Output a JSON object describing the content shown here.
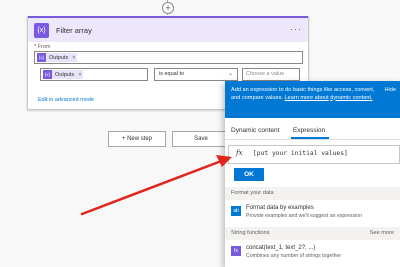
{
  "add_step_symbol": "+",
  "action": {
    "icon_text": "{x}",
    "title": "Filter array",
    "more": "···",
    "from_label": "From",
    "from_required": "*",
    "from_token": {
      "icon_text": "{x}",
      "label": "Outputs",
      "close": "×"
    },
    "value_token": {
      "icon_text": "{x}",
      "label": "Outputs",
      "close": "×"
    },
    "operator_value": "is equal to",
    "operator_chevron": "⌄",
    "value_placeholder": "Choose a value",
    "advanced_link": "Edit in advanced mode"
  },
  "buttons": {
    "new_step": "+ New step",
    "save": "Save"
  },
  "expression_panel": {
    "info_text_1": "Add an expression to do basic things like access, convert, and compare values.",
    "info_link_1": "Learn more about",
    "info_link_2": "dynamic content.",
    "hide": "Hide",
    "tabs": {
      "dynamic": "Dynamic content",
      "expression": "Expression"
    },
    "fx_icon": "fx",
    "input_value": "[put your initial values]",
    "ok": "OK",
    "sections": {
      "format": "Format your data",
      "string": "String functions",
      "see_more": "See more"
    },
    "functions": [
      {
        "icon_text": "ab",
        "title": "Format data by examples",
        "desc": "Provide examples and we'll suggest an expression"
      },
      {
        "icon_text": "fx",
        "title": "concat(text_1, text_2?, ...)",
        "desc": "Combines any number of strings together"
      }
    ]
  },
  "colors": {
    "accent_purple": "#7a5ae0",
    "link_blue": "#0078d4",
    "arrow_red": "#e3241b"
  }
}
